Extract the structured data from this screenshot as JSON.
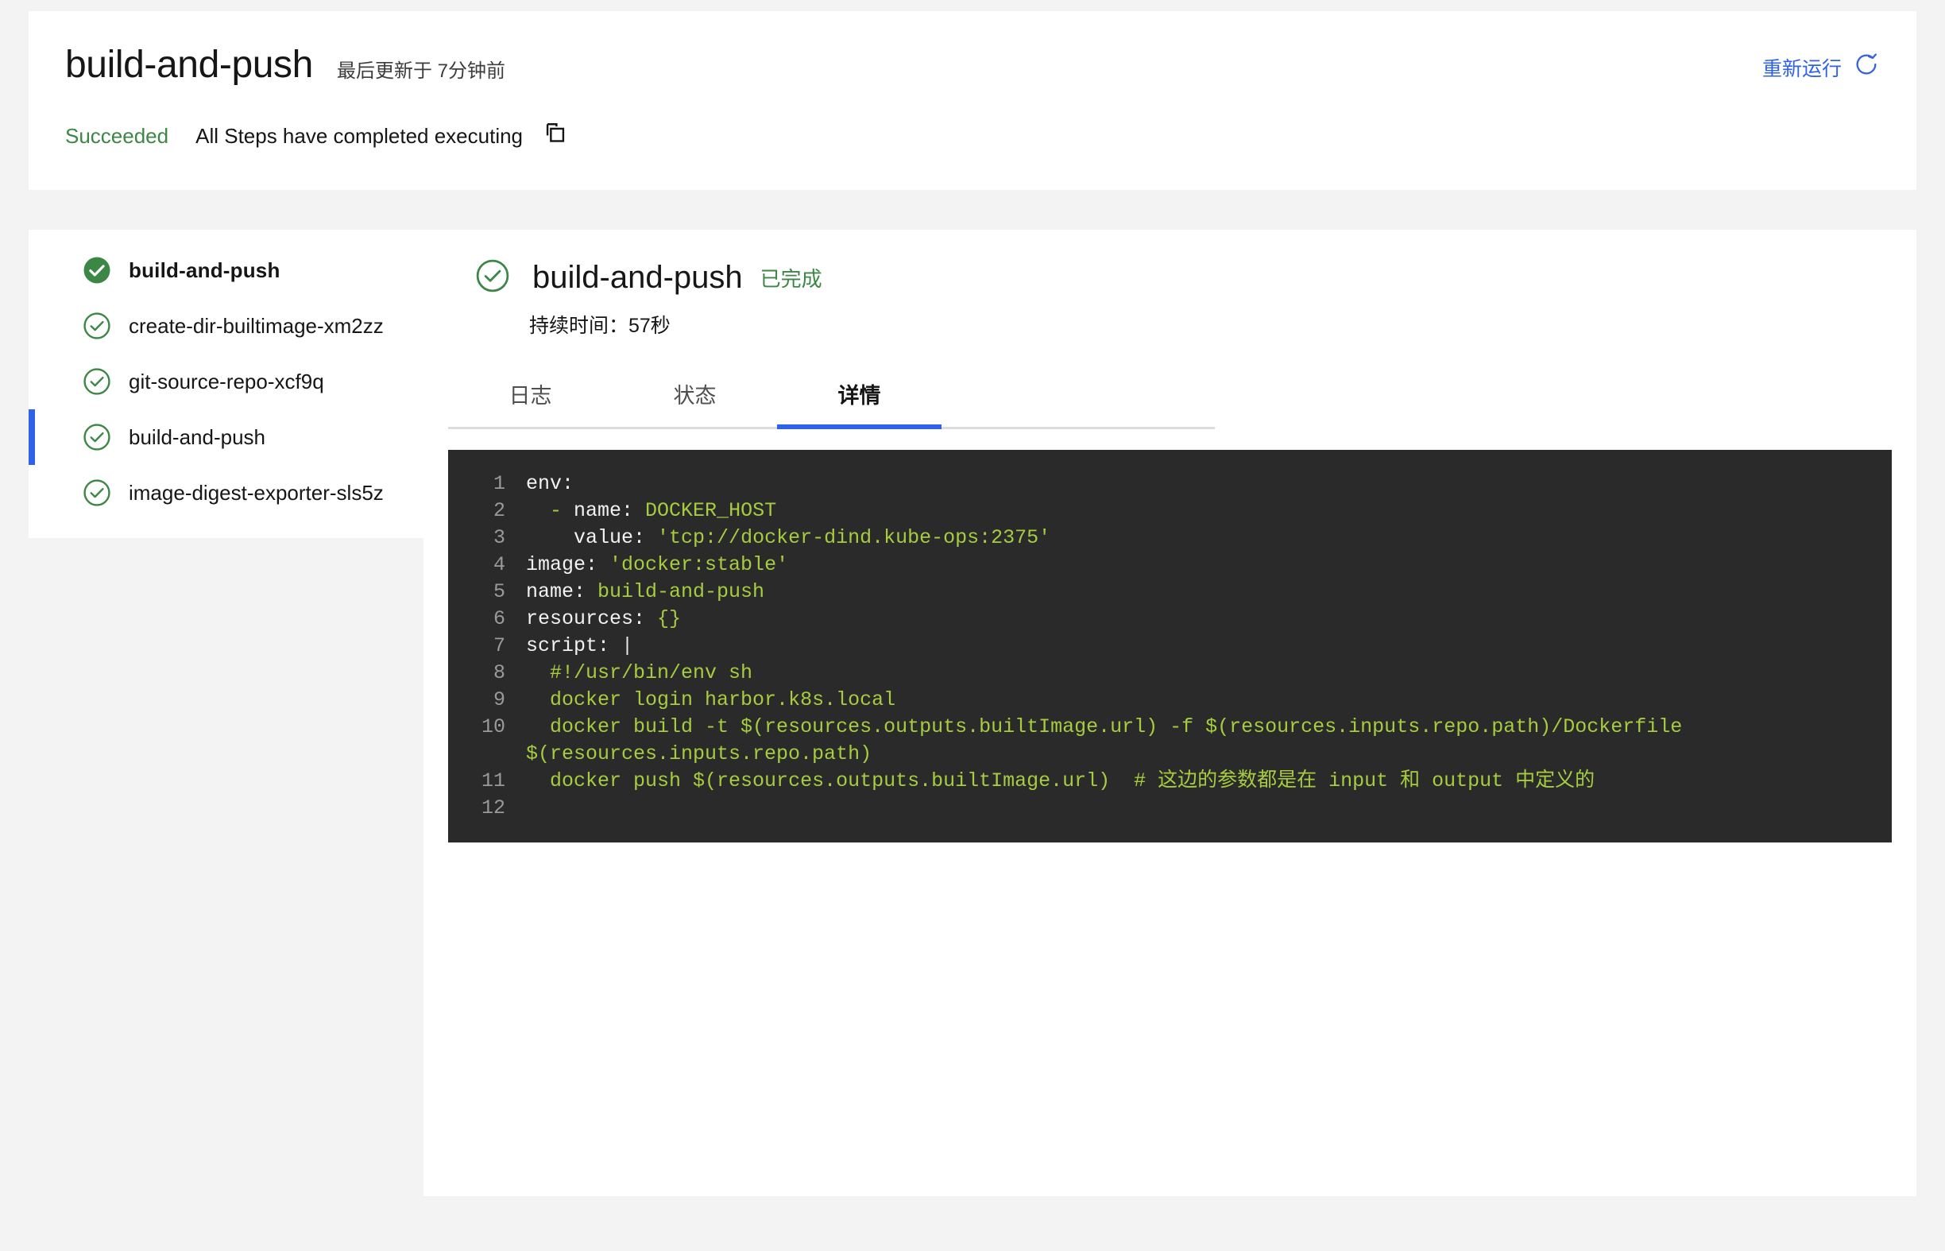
{
  "header": {
    "pipeline_title": "build-and-push",
    "updated_text": "最后更新于 7分钟前",
    "rerun_label": "重新运行",
    "rerun_icon": "refresh-icon",
    "status_label": "Succeeded",
    "status_message": "All Steps have completed executing",
    "copy_icon": "copy-icon",
    "accent_blue": "#2f62e8",
    "success_green": "#3c8745"
  },
  "sidebar": {
    "items": [
      {
        "label": "build-and-push",
        "icon": "check-circle-filled-icon",
        "state": "succeeded",
        "root": true,
        "selected": false
      },
      {
        "label": "create-dir-builtimage-xm2zz",
        "icon": "check-circle-icon",
        "state": "succeeded",
        "root": false,
        "selected": false
      },
      {
        "label": "git-source-repo-xcf9q",
        "icon": "check-circle-icon",
        "state": "succeeded",
        "root": false,
        "selected": false
      },
      {
        "label": "build-and-push",
        "icon": "check-circle-icon",
        "state": "succeeded",
        "root": false,
        "selected": true
      },
      {
        "label": "image-digest-exporter-sls5z",
        "icon": "check-circle-icon",
        "state": "succeeded",
        "root": false,
        "selected": false
      }
    ]
  },
  "main": {
    "task_icon": "check-circle-icon",
    "task_name": "build-and-push",
    "task_state": "已完成",
    "task_duration": "持续时间：57秒",
    "tabs": [
      {
        "label": "日志",
        "active": false
      },
      {
        "label": "状态",
        "active": false
      },
      {
        "label": "详情",
        "active": true
      }
    ],
    "code": {
      "language": "yaml",
      "lines": [
        {
          "n": "1",
          "segments": [
            {
              "t": "env:",
              "c": "key"
            }
          ]
        },
        {
          "n": "2",
          "segments": [
            {
              "t": "  - ",
              "c": "val"
            },
            {
              "t": "name: ",
              "c": "key"
            },
            {
              "t": "DOCKER_HOST",
              "c": "val"
            }
          ]
        },
        {
          "n": "3",
          "segments": [
            {
              "t": "    value: ",
              "c": "key"
            },
            {
              "t": "'tcp://docker-dind.kube-ops:2375'",
              "c": "val"
            }
          ]
        },
        {
          "n": "4",
          "segments": [
            {
              "t": "image: ",
              "c": "key"
            },
            {
              "t": "'docker:stable'",
              "c": "val"
            }
          ]
        },
        {
          "n": "5",
          "segments": [
            {
              "t": "name: ",
              "c": "key"
            },
            {
              "t": "build-and-push",
              "c": "val"
            }
          ]
        },
        {
          "n": "6",
          "segments": [
            {
              "t": "resources: ",
              "c": "key"
            },
            {
              "t": "{}",
              "c": "val"
            }
          ]
        },
        {
          "n": "7",
          "segments": [
            {
              "t": "script: ",
              "c": "key"
            },
            {
              "t": "|",
              "c": "plain"
            }
          ]
        },
        {
          "n": "8",
          "segments": [
            {
              "t": "  #!/usr/bin/env sh",
              "c": "val"
            }
          ]
        },
        {
          "n": "9",
          "segments": [
            {
              "t": "  docker login harbor.k8s.local",
              "c": "val"
            }
          ]
        },
        {
          "n": "10",
          "segments": [
            {
              "t": "  docker build -t $(resources.outputs.builtImage.url) -f $(resources.inputs.repo.path)/Dockerfile $(resources.inputs.repo.path)",
              "c": "val"
            }
          ]
        },
        {
          "n": "11",
          "segments": [
            {
              "t": "  docker push $(resources.outputs.builtImage.url)  ",
              "c": "val"
            },
            {
              "t": "# 这边的参数都是在 input 和 output 中定义的",
              "c": "cmt"
            }
          ]
        },
        {
          "n": "12",
          "segments": [
            {
              "t": "",
              "c": "plain"
            }
          ]
        }
      ]
    }
  }
}
